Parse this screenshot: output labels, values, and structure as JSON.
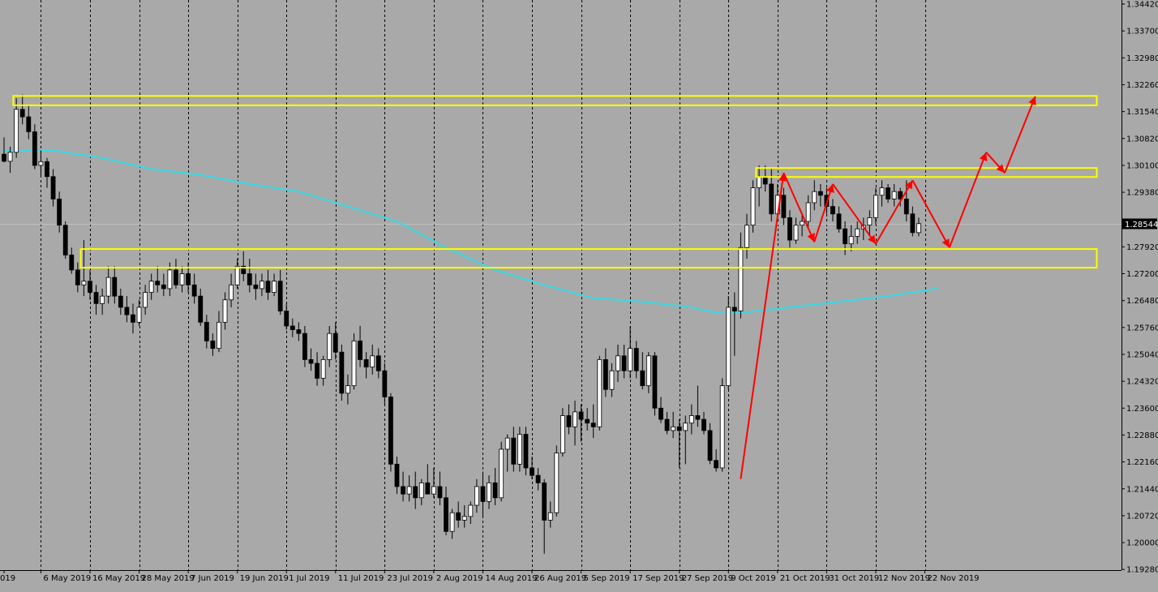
{
  "colors": {
    "background": "#a9a9a9",
    "bull_body": "#ffffff",
    "bear_body": "#000000",
    "candle_outline": "#000000",
    "moving_average": "#3fd7e0",
    "zones": "#ffff00",
    "projection": "#ff0000",
    "grid": "#000000",
    "price_tag_bg": "#000000",
    "price_tag_text": "#ffffff"
  },
  "chart_data": {
    "type": "candlestick",
    "title": "",
    "xlabel": "",
    "ylabel": "",
    "ylim": [
      1.1935,
      1.3442
    ],
    "grid": "vertical dotted",
    "price_ticks": [
      "1.34420",
      "1.33700",
      "1.32980",
      "1.32260",
      "1.31540",
      "1.30820",
      "1.30100",
      "1.29380",
      "1.27920",
      "1.27200",
      "1.26480",
      "1.25760",
      "1.25040",
      "1.24320",
      "1.23600",
      "1.22880",
      "1.22160",
      "1.21440",
      "1.20720",
      "1.20000",
      "1.19280"
    ],
    "current_price": "1.28544",
    "date_labels": [
      {
        "label": "019",
        "bar": 0
      },
      {
        "label": "6 May 2019",
        "bar": 6
      },
      {
        "label": "16 May 2019",
        "bar": 14
      },
      {
        "label": "28 May 2019",
        "bar": 22
      },
      {
        "label": "7 Jun 2019",
        "bar": 30
      },
      {
        "label": "19 Jun 2019",
        "bar": 38
      },
      {
        "label": "1 Jul 2019",
        "bar": 46
      },
      {
        "label": "11 Jul 2019",
        "bar": 54
      },
      {
        "label": "23 Jul 2019",
        "bar": 62
      },
      {
        "label": "2 Aug 2019",
        "bar": 70
      },
      {
        "label": "14 Aug 2019",
        "bar": 78
      },
      {
        "label": "26 Aug 2019",
        "bar": 86
      },
      {
        "label": "5 Sep 2019",
        "bar": 94
      },
      {
        "label": "17 Sep 2019",
        "bar": 102
      },
      {
        "label": "27 Sep 2019",
        "bar": 110
      },
      {
        "label": "9 Oct 2019",
        "bar": 118
      },
      {
        "label": "21 Oct 2019",
        "bar": 126
      },
      {
        "label": "31 Oct 2019",
        "bar": 134
      },
      {
        "label": "12 Nov 2019",
        "bar": 142
      },
      {
        "label": "22 Nov 2019",
        "bar": 150
      }
    ],
    "candles": [
      {
        "o": 1.304,
        "h": 1.3085,
        "l": 1.3018,
        "c": 1.3021
      },
      {
        "o": 1.3021,
        "h": 1.306,
        "l": 1.299,
        "c": 1.3045
      },
      {
        "o": 1.3045,
        "h": 1.319,
        "l": 1.303,
        "c": 1.316
      },
      {
        "o": 1.316,
        "h": 1.32,
        "l": 1.312,
        "c": 1.314
      },
      {
        "o": 1.314,
        "h": 1.317,
        "l": 1.308,
        "c": 1.31
      },
      {
        "o": 1.31,
        "h": 1.312,
        "l": 1.3,
        "c": 1.301
      },
      {
        "o": 1.301,
        "h": 1.305,
        "l": 1.298,
        "c": 1.302
      },
      {
        "o": 1.302,
        "h": 1.303,
        "l": 1.295,
        "c": 1.298
      },
      {
        "o": 1.298,
        "h": 1.3,
        "l": 1.29,
        "c": 1.292
      },
      {
        "o": 1.292,
        "h": 1.294,
        "l": 1.283,
        "c": 1.285
      },
      {
        "o": 1.285,
        "h": 1.286,
        "l": 1.276,
        "c": 1.277
      },
      {
        "o": 1.277,
        "h": 1.279,
        "l": 1.272,
        "c": 1.273
      },
      {
        "o": 1.273,
        "h": 1.275,
        "l": 1.267,
        "c": 1.269
      },
      {
        "o": 1.269,
        "h": 1.281,
        "l": 1.266,
        "c": 1.27
      },
      {
        "o": 1.27,
        "h": 1.273,
        "l": 1.265,
        "c": 1.267
      },
      {
        "o": 1.267,
        "h": 1.269,
        "l": 1.261,
        "c": 1.264
      },
      {
        "o": 1.264,
        "h": 1.268,
        "l": 1.261,
        "c": 1.266
      },
      {
        "o": 1.266,
        "h": 1.274,
        "l": 1.264,
        "c": 1.271
      },
      {
        "o": 1.271,
        "h": 1.274,
        "l": 1.264,
        "c": 1.266
      },
      {
        "o": 1.266,
        "h": 1.268,
        "l": 1.261,
        "c": 1.263
      },
      {
        "o": 1.263,
        "h": 1.266,
        "l": 1.259,
        "c": 1.261
      },
      {
        "o": 1.261,
        "h": 1.264,
        "l": 1.256,
        "c": 1.259
      },
      {
        "o": 1.259,
        "h": 1.265,
        "l": 1.258,
        "c": 1.263
      },
      {
        "o": 1.263,
        "h": 1.269,
        "l": 1.261,
        "c": 1.267
      },
      {
        "o": 1.267,
        "h": 1.272,
        "l": 1.265,
        "c": 1.27
      },
      {
        "o": 1.27,
        "h": 1.274,
        "l": 1.267,
        "c": 1.269
      },
      {
        "o": 1.269,
        "h": 1.272,
        "l": 1.266,
        "c": 1.268
      },
      {
        "o": 1.268,
        "h": 1.275,
        "l": 1.266,
        "c": 1.273
      },
      {
        "o": 1.273,
        "h": 1.276,
        "l": 1.268,
        "c": 1.269
      },
      {
        "o": 1.269,
        "h": 1.274,
        "l": 1.267,
        "c": 1.272
      },
      {
        "o": 1.272,
        "h": 1.275,
        "l": 1.267,
        "c": 1.269
      },
      {
        "o": 1.269,
        "h": 1.272,
        "l": 1.264,
        "c": 1.266
      },
      {
        "o": 1.266,
        "h": 1.268,
        "l": 1.258,
        "c": 1.259
      },
      {
        "o": 1.259,
        "h": 1.261,
        "l": 1.252,
        "c": 1.254
      },
      {
        "o": 1.254,
        "h": 1.256,
        "l": 1.25,
        "c": 1.252
      },
      {
        "o": 1.252,
        "h": 1.262,
        "l": 1.251,
        "c": 1.259
      },
      {
        "o": 1.259,
        "h": 1.267,
        "l": 1.257,
        "c": 1.265
      },
      {
        "o": 1.265,
        "h": 1.272,
        "l": 1.263,
        "c": 1.269
      },
      {
        "o": 1.269,
        "h": 1.276,
        "l": 1.268,
        "c": 1.274
      },
      {
        "o": 1.274,
        "h": 1.278,
        "l": 1.27,
        "c": 1.272
      },
      {
        "o": 1.272,
        "h": 1.276,
        "l": 1.267,
        "c": 1.269
      },
      {
        "o": 1.269,
        "h": 1.272,
        "l": 1.265,
        "c": 1.268
      },
      {
        "o": 1.268,
        "h": 1.272,
        "l": 1.266,
        "c": 1.27
      },
      {
        "o": 1.27,
        "h": 1.273,
        "l": 1.265,
        "c": 1.267
      },
      {
        "o": 1.267,
        "h": 1.272,
        "l": 1.266,
        "c": 1.27
      },
      {
        "o": 1.27,
        "h": 1.273,
        "l": 1.261,
        "c": 1.262
      },
      {
        "o": 1.262,
        "h": 1.264,
        "l": 1.257,
        "c": 1.258
      },
      {
        "o": 1.258,
        "h": 1.26,
        "l": 1.255,
        "c": 1.257
      },
      {
        "o": 1.257,
        "h": 1.259,
        "l": 1.254,
        "c": 1.256
      },
      {
        "o": 1.256,
        "h": 1.258,
        "l": 1.247,
        "c": 1.249
      },
      {
        "o": 1.249,
        "h": 1.252,
        "l": 1.246,
        "c": 1.248
      },
      {
        "o": 1.248,
        "h": 1.251,
        "l": 1.242,
        "c": 1.244
      },
      {
        "o": 1.244,
        "h": 1.25,
        "l": 1.242,
        "c": 1.249
      },
      {
        "o": 1.249,
        "h": 1.258,
        "l": 1.247,
        "c": 1.256
      },
      {
        "o": 1.256,
        "h": 1.259,
        "l": 1.249,
        "c": 1.251
      },
      {
        "o": 1.251,
        "h": 1.253,
        "l": 1.238,
        "c": 1.24
      },
      {
        "o": 1.24,
        "h": 1.245,
        "l": 1.237,
        "c": 1.242
      },
      {
        "o": 1.242,
        "h": 1.256,
        "l": 1.241,
        "c": 1.254
      },
      {
        "o": 1.254,
        "h": 1.258,
        "l": 1.247,
        "c": 1.249
      },
      {
        "o": 1.249,
        "h": 1.251,
        "l": 1.244,
        "c": 1.247
      },
      {
        "o": 1.247,
        "h": 1.253,
        "l": 1.245,
        "c": 1.25
      },
      {
        "o": 1.25,
        "h": 1.252,
        "l": 1.244,
        "c": 1.246
      },
      {
        "o": 1.246,
        "h": 1.248,
        "l": 1.237,
        "c": 1.239
      },
      {
        "o": 1.239,
        "h": 1.24,
        "l": 1.219,
        "c": 1.221
      },
      {
        "o": 1.221,
        "h": 1.223,
        "l": 1.213,
        "c": 1.215
      },
      {
        "o": 1.215,
        "h": 1.219,
        "l": 1.211,
        "c": 1.213
      },
      {
        "o": 1.213,
        "h": 1.218,
        "l": 1.211,
        "c": 1.215
      },
      {
        "o": 1.215,
        "h": 1.219,
        "l": 1.209,
        "c": 1.212
      },
      {
        "o": 1.212,
        "h": 1.217,
        "l": 1.21,
        "c": 1.216
      },
      {
        "o": 1.216,
        "h": 1.221,
        "l": 1.213,
        "c": 1.213
      },
      {
        "o": 1.213,
        "h": 1.22,
        "l": 1.212,
        "c": 1.215
      },
      {
        "o": 1.215,
        "h": 1.219,
        "l": 1.21,
        "c": 1.212
      },
      {
        "o": 1.212,
        "h": 1.215,
        "l": 1.202,
        "c": 1.203
      },
      {
        "o": 1.203,
        "h": 1.209,
        "l": 1.201,
        "c": 1.208
      },
      {
        "o": 1.208,
        "h": 1.211,
        "l": 1.204,
        "c": 1.206
      },
      {
        "o": 1.206,
        "h": 1.21,
        "l": 1.204,
        "c": 1.207
      },
      {
        "o": 1.207,
        "h": 1.211,
        "l": 1.205,
        "c": 1.21
      },
      {
        "o": 1.21,
        "h": 1.217,
        "l": 1.208,
        "c": 1.215
      },
      {
        "o": 1.215,
        "h": 1.219,
        "l": 1.207,
        "c": 1.211
      },
      {
        "o": 1.211,
        "h": 1.218,
        "l": 1.209,
        "c": 1.216
      },
      {
        "o": 1.216,
        "h": 1.22,
        "l": 1.21,
        "c": 1.212
      },
      {
        "o": 1.212,
        "h": 1.227,
        "l": 1.211,
        "c": 1.225
      },
      {
        "o": 1.225,
        "h": 1.229,
        "l": 1.219,
        "c": 1.228
      },
      {
        "o": 1.228,
        "h": 1.231,
        "l": 1.219,
        "c": 1.221
      },
      {
        "o": 1.221,
        "h": 1.231,
        "l": 1.219,
        "c": 1.229
      },
      {
        "o": 1.229,
        "h": 1.231,
        "l": 1.218,
        "c": 1.22
      },
      {
        "o": 1.22,
        "h": 1.223,
        "l": 1.217,
        "c": 1.218
      },
      {
        "o": 1.218,
        "h": 1.22,
        "l": 1.214,
        "c": 1.216
      },
      {
        "o": 1.216,
        "h": 1.217,
        "l": 1.197,
        "c": 1.206
      },
      {
        "o": 1.206,
        "h": 1.211,
        "l": 1.204,
        "c": 1.208
      },
      {
        "o": 1.208,
        "h": 1.226,
        "l": 1.207,
        "c": 1.224
      },
      {
        "o": 1.224,
        "h": 1.236,
        "l": 1.223,
        "c": 1.234
      },
      {
        "o": 1.234,
        "h": 1.237,
        "l": 1.229,
        "c": 1.231
      },
      {
        "o": 1.231,
        "h": 1.238,
        "l": 1.226,
        "c": 1.235
      },
      {
        "o": 1.235,
        "h": 1.237,
        "l": 1.227,
        "c": 1.233
      },
      {
        "o": 1.233,
        "h": 1.236,
        "l": 1.23,
        "c": 1.232
      },
      {
        "o": 1.232,
        "h": 1.237,
        "l": 1.228,
        "c": 1.231
      },
      {
        "o": 1.231,
        "h": 1.25,
        "l": 1.23,
        "c": 1.249
      },
      {
        "o": 1.249,
        "h": 1.252,
        "l": 1.239,
        "c": 1.241
      },
      {
        "o": 1.241,
        "h": 1.248,
        "l": 1.239,
        "c": 1.246
      },
      {
        "o": 1.246,
        "h": 1.253,
        "l": 1.243,
        "c": 1.25
      },
      {
        "o": 1.25,
        "h": 1.253,
        "l": 1.244,
        "c": 1.246
      },
      {
        "o": 1.246,
        "h": 1.258,
        "l": 1.244,
        "c": 1.252
      },
      {
        "o": 1.252,
        "h": 1.254,
        "l": 1.244,
        "c": 1.246
      },
      {
        "o": 1.246,
        "h": 1.251,
        "l": 1.241,
        "c": 1.242
      },
      {
        "o": 1.242,
        "h": 1.251,
        "l": 1.24,
        "c": 1.25
      },
      {
        "o": 1.25,
        "h": 1.251,
        "l": 1.234,
        "c": 1.236
      },
      {
        "o": 1.236,
        "h": 1.239,
        "l": 1.232,
        "c": 1.233
      },
      {
        "o": 1.233,
        "h": 1.235,
        "l": 1.229,
        "c": 1.23
      },
      {
        "o": 1.23,
        "h": 1.235,
        "l": 1.228,
        "c": 1.231
      },
      {
        "o": 1.231,
        "h": 1.233,
        "l": 1.22,
        "c": 1.23
      },
      {
        "o": 1.23,
        "h": 1.234,
        "l": 1.221,
        "c": 1.232
      },
      {
        "o": 1.232,
        "h": 1.237,
        "l": 1.229,
        "c": 1.234
      },
      {
        "o": 1.234,
        "h": 1.242,
        "l": 1.231,
        "c": 1.233
      },
      {
        "o": 1.233,
        "h": 1.235,
        "l": 1.229,
        "c": 1.23
      },
      {
        "o": 1.23,
        "h": 1.232,
        "l": 1.221,
        "c": 1.222
      },
      {
        "o": 1.222,
        "h": 1.225,
        "l": 1.219,
        "c": 1.22
      },
      {
        "o": 1.22,
        "h": 1.244,
        "l": 1.219,
        "c": 1.242
      },
      {
        "o": 1.242,
        "h": 1.266,
        "l": 1.241,
        "c": 1.263
      },
      {
        "o": 1.263,
        "h": 1.267,
        "l": 1.25,
        "c": 1.262
      },
      {
        "o": 1.262,
        "h": 1.283,
        "l": 1.26,
        "c": 1.279
      },
      {
        "o": 1.279,
        "h": 1.288,
        "l": 1.276,
        "c": 1.285
      },
      {
        "o": 1.285,
        "h": 1.297,
        "l": 1.283,
        "c": 1.295
      },
      {
        "o": 1.295,
        "h": 1.301,
        "l": 1.29,
        "c": 1.298
      },
      {
        "o": 1.298,
        "h": 1.301,
        "l": 1.294,
        "c": 1.296
      },
      {
        "o": 1.296,
        "h": 1.3,
        "l": 1.286,
        "c": 1.288
      },
      {
        "o": 1.288,
        "h": 1.296,
        "l": 1.286,
        "c": 1.293
      },
      {
        "o": 1.293,
        "h": 1.295,
        "l": 1.285,
        "c": 1.287
      },
      {
        "o": 1.287,
        "h": 1.289,
        "l": 1.279,
        "c": 1.281
      },
      {
        "o": 1.281,
        "h": 1.287,
        "l": 1.28,
        "c": 1.285
      },
      {
        "o": 1.285,
        "h": 1.288,
        "l": 1.282,
        "c": 1.286
      },
      {
        "o": 1.286,
        "h": 1.293,
        "l": 1.284,
        "c": 1.291
      },
      {
        "o": 1.291,
        "h": 1.297,
        "l": 1.289,
        "c": 1.294
      },
      {
        "o": 1.294,
        "h": 1.296,
        "l": 1.29,
        "c": 1.293
      },
      {
        "o": 1.293,
        "h": 1.295,
        "l": 1.288,
        "c": 1.29
      },
      {
        "o": 1.29,
        "h": 1.292,
        "l": 1.286,
        "c": 1.288
      },
      {
        "o": 1.288,
        "h": 1.29,
        "l": 1.283,
        "c": 1.284
      },
      {
        "o": 1.284,
        "h": 1.286,
        "l": 1.277,
        "c": 1.28
      },
      {
        "o": 1.28,
        "h": 1.285,
        "l": 1.278,
        "c": 1.282
      },
      {
        "o": 1.282,
        "h": 1.286,
        "l": 1.28,
        "c": 1.284
      },
      {
        "o": 1.284,
        "h": 1.287,
        "l": 1.281,
        "c": 1.285
      },
      {
        "o": 1.285,
        "h": 1.289,
        "l": 1.282,
        "c": 1.287
      },
      {
        "o": 1.287,
        "h": 1.295,
        "l": 1.285,
        "c": 1.293
      },
      {
        "o": 1.293,
        "h": 1.297,
        "l": 1.29,
        "c": 1.295
      },
      {
        "o": 1.295,
        "h": 1.296,
        "l": 1.291,
        "c": 1.292
      },
      {
        "o": 1.292,
        "h": 1.296,
        "l": 1.29,
        "c": 1.294
      },
      {
        "o": 1.294,
        "h": 1.295,
        "l": 1.29,
        "c": 1.292
      },
      {
        "o": 1.292,
        "h": 1.297,
        "l": 1.286,
        "c": 1.288
      },
      {
        "o": 1.288,
        "h": 1.29,
        "l": 1.282,
        "c": 1.283
      },
      {
        "o": 1.283,
        "h": 1.287,
        "l": 1.282,
        "c": 1.2854
      }
    ],
    "moving_average": [
      {
        "bar": 0,
        "v": 1.305
      },
      {
        "bar": 8,
        "v": 1.305
      },
      {
        "bar": 16,
        "v": 1.303
      },
      {
        "bar": 24,
        "v": 1.3
      },
      {
        "bar": 32,
        "v": 1.2985
      },
      {
        "bar": 40,
        "v": 1.296
      },
      {
        "bar": 48,
        "v": 1.294
      },
      {
        "bar": 56,
        "v": 1.29
      },
      {
        "bar": 64,
        "v": 1.286
      },
      {
        "bar": 72,
        "v": 1.279
      },
      {
        "bar": 80,
        "v": 1.273
      },
      {
        "bar": 88,
        "v": 1.269
      },
      {
        "bar": 96,
        "v": 1.2655
      },
      {
        "bar": 104,
        "v": 1.2645
      },
      {
        "bar": 112,
        "v": 1.263
      },
      {
        "bar": 116,
        "v": 1.2615
      },
      {
        "bar": 120,
        "v": 1.2615
      },
      {
        "bar": 128,
        "v": 1.263
      },
      {
        "bar": 136,
        "v": 1.2645
      },
      {
        "bar": 144,
        "v": 1.266
      },
      {
        "bar": 152,
        "v": 1.268
      }
    ],
    "zones": [
      {
        "bar_from": 1.5,
        "bar_to": 178,
        "y_from": 1.3171,
        "y_to": 1.3196
      },
      {
        "bar_from": 122.5,
        "bar_to": 178,
        "y_from": 1.2979,
        "y_to": 1.3003
      },
      {
        "bar_from": 12.5,
        "bar_to": 178,
        "y_from": 1.2736,
        "y_to": 1.2786
      }
    ],
    "projection": [
      {
        "bar": 120,
        "v": 1.217
      },
      {
        "bar": 127,
        "v": 1.299
      },
      {
        "bar": 132,
        "v": 1.2805
      },
      {
        "bar": 135,
        "v": 1.296
      },
      {
        "bar": 142,
        "v": 1.28
      },
      {
        "bar": 148,
        "v": 1.297
      },
      {
        "bar": 154,
        "v": 1.279
      },
      {
        "bar": 160,
        "v": 1.3045
      },
      {
        "bar": 163,
        "v": 1.299
      },
      {
        "bar": 168,
        "v": 1.3195
      }
    ]
  }
}
